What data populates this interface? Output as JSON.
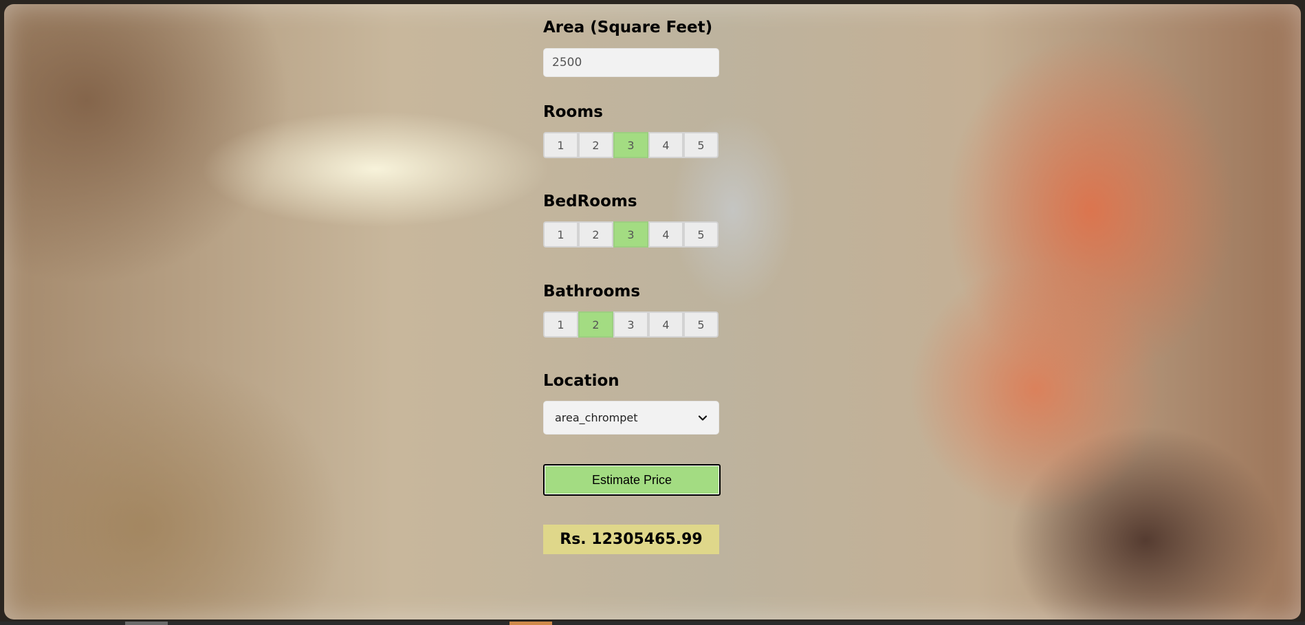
{
  "form": {
    "area": {
      "label": "Area (Square Feet)",
      "value": "2500"
    },
    "rooms": {
      "label": "Rooms",
      "options": [
        "1",
        "2",
        "3",
        "4",
        "5"
      ],
      "selected": "3"
    },
    "bedrooms": {
      "label": "BedRooms",
      "options": [
        "1",
        "2",
        "3",
        "4",
        "5"
      ],
      "selected": "3"
    },
    "bathrooms": {
      "label": "Bathrooms",
      "options": [
        "1",
        "2",
        "3",
        "4",
        "5"
      ],
      "selected": "2"
    },
    "location": {
      "label": "Location",
      "selected": "area_chrompet"
    },
    "estimate_button": "Estimate Price",
    "result": "Rs. 12305465.99"
  },
  "colors": {
    "active_option": "#a3dc82",
    "result_background": "#dfd78a",
    "button_background": "#a3dc82"
  },
  "icons": {
    "location_dropdown": "chevron-down-icon"
  }
}
